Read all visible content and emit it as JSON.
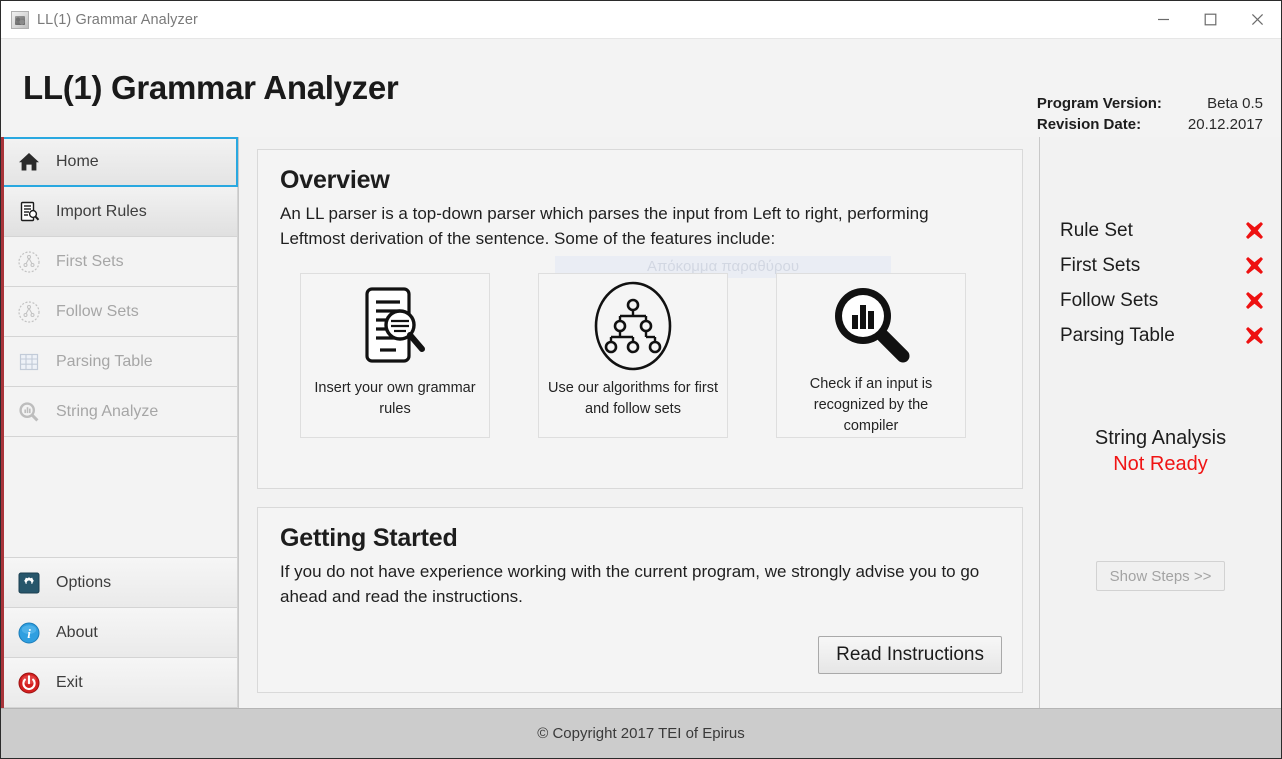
{
  "window": {
    "title": "LL(1) Grammar Analyzer",
    "icon": "app-icon",
    "controls": {
      "minimize": "minimize-icon",
      "maximize": "maximize-icon",
      "close": "close-icon"
    }
  },
  "header": {
    "app_title": "LL(1) Grammar Analyzer",
    "version_label": "Program Version:",
    "version_value": "Beta 0.5",
    "revision_label": "Revision Date:",
    "revision_value": "20.12.2017"
  },
  "sidebar": {
    "items": [
      {
        "label": "Home",
        "icon": "home-icon",
        "state": "selected"
      },
      {
        "label": "Import Rules",
        "icon": "import-rules-icon",
        "state": "active"
      },
      {
        "label": "First Sets",
        "icon": "first-sets-icon",
        "state": "disabled"
      },
      {
        "label": "Follow Sets",
        "icon": "follow-sets-icon",
        "state": "disabled"
      },
      {
        "label": "Parsing Table",
        "icon": "parsing-table-icon",
        "state": "disabled"
      },
      {
        "label": "String Analyze",
        "icon": "string-analyze-icon",
        "state": "disabled"
      }
    ],
    "bottom_items": [
      {
        "label": "Options",
        "icon": "gear-icon"
      },
      {
        "label": "About",
        "icon": "info-icon"
      },
      {
        "label": "Exit",
        "icon": "power-icon"
      }
    ]
  },
  "overview": {
    "heading": "Overview",
    "paragraph": "An LL parser is a top-down parser which parses the input from Left to right, performing Leftmost derivation of the sentence. Some of the features include:",
    "watermark": "Απόκομμα παραθύρου",
    "cards": [
      {
        "caption": "Insert your own grammar rules",
        "icon": "document-search-icon"
      },
      {
        "caption": "Use our algorithms for first and follow sets",
        "icon": "tree-graph-icon"
      },
      {
        "caption": "Check if an input is recognized by the compiler",
        "icon": "chart-magnifier-icon"
      }
    ]
  },
  "getting_started": {
    "heading": "Getting Started",
    "paragraph": "If you do not have experience working with the current program, we strongly advise you to go ahead and read the instructions.",
    "button_label": "Read Instructions"
  },
  "status_panel": {
    "items": [
      {
        "label": "Rule Set",
        "mark": "red-x-icon"
      },
      {
        "label": "First Sets",
        "mark": "red-x-icon"
      },
      {
        "label": "Follow Sets",
        "mark": "red-x-icon"
      },
      {
        "label": "Parsing Table",
        "mark": "red-x-icon"
      }
    ],
    "analysis_title": "String Analysis",
    "analysis_state": "Not Ready",
    "show_steps_label": "Show Steps >>"
  },
  "footer": {
    "copyright": "© Copyright 2017 TEI of Epirus"
  },
  "colors": {
    "accent_selected": "#29a8e0",
    "accent_stripe": "#a8343a",
    "status_error": "#f01414",
    "not_ready": "#f01414"
  }
}
